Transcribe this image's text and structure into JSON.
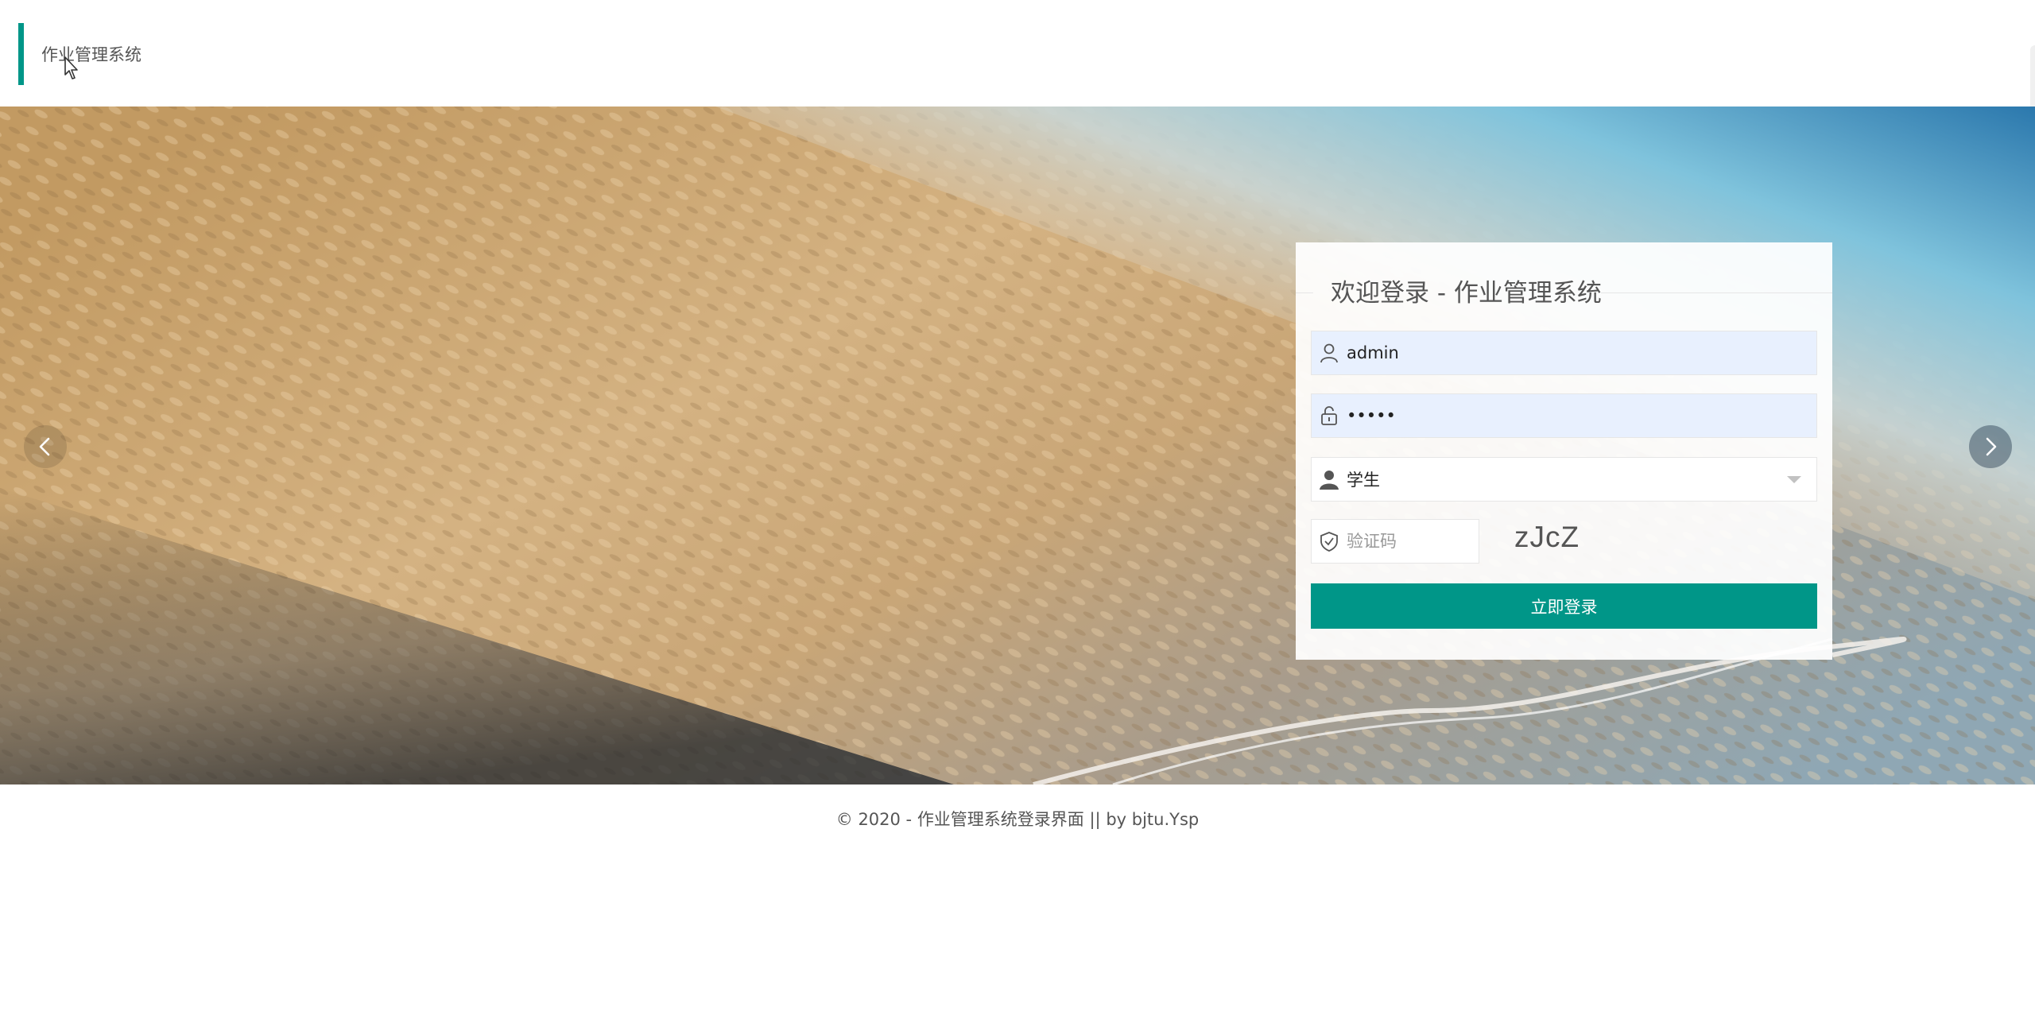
{
  "header": {
    "title": "作业管理系统",
    "accent_color": "#009688"
  },
  "carousel": {
    "prev_icon": "chevron-left-icon",
    "next_icon": "chevron-right-icon"
  },
  "login": {
    "legend": "欢迎登录 - 作业管理系统",
    "username": {
      "icon": "user-icon",
      "value": "admin"
    },
    "password": {
      "icon": "lock-icon",
      "value": "•••••"
    },
    "role": {
      "icon": "person-icon",
      "selected": "学生"
    },
    "captcha": {
      "icon": "shield-check-icon",
      "placeholder": "验证码",
      "code": "zJcZ"
    },
    "submit_label": "立即登录"
  },
  "footer": {
    "text": "© 2020 - 作业管理系统登录界面 || by bjtu.Ysp"
  }
}
